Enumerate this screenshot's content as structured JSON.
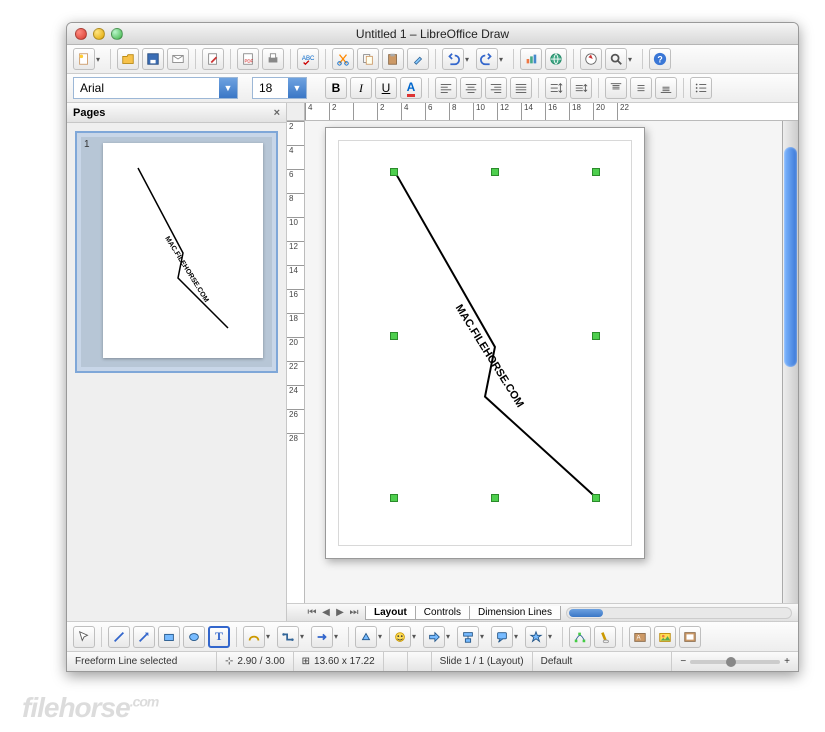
{
  "window": {
    "title": "Untitled 1 – LibreOffice Draw"
  },
  "toolbar1": {
    "new": "New",
    "open": "Open",
    "save": "Save",
    "email": "E-mail",
    "edit": "Edit",
    "pdf": "PDF",
    "print": "Print",
    "spell": "Spelling",
    "cut": "Cut",
    "copy": "Copy",
    "paste": "Paste",
    "fmtbrush": "Format Paintbrush",
    "undo": "Undo",
    "redo": "Redo",
    "chart": "Chart",
    "hyperlink": "Hyperlink",
    "navigator": "Navigator",
    "zoom": "Zoom",
    "help": "Help"
  },
  "toolbar2": {
    "font_name": "Arial",
    "font_size": "18",
    "bold": "B",
    "italic": "I",
    "underline": "U",
    "fontcolor": "A",
    "align_left": "Left",
    "align_center": "Center",
    "align_right": "Right",
    "align_just": "Justify",
    "inc_spc": "Increase Spacing",
    "dec_spc": "Decrease Spacing",
    "top": "Top",
    "vcenter": "Center",
    "bottom": "Bottom",
    "bullets": "Bullets"
  },
  "pages_panel": {
    "title": "Pages",
    "close": "×",
    "thumb_number": "1",
    "thumb_text": "MAC.FILEHORSE.COM"
  },
  "rulers": {
    "h": [
      "4",
      "2",
      "",
      "2",
      "4",
      "6",
      "8",
      "10",
      "12",
      "14",
      "16",
      "18",
      "20",
      "22"
    ],
    "v": [
      "2",
      "4",
      "6",
      "8",
      "10",
      "12",
      "14",
      "16",
      "18",
      "20",
      "22",
      "24",
      "26",
      "28"
    ]
  },
  "canvas": {
    "object_text": "MAC.FILEHORSE.COM"
  },
  "tabs": {
    "layout": "Layout",
    "controls": "Controls",
    "dimension": "Dimension Lines"
  },
  "drawbar": {
    "select": "Select",
    "line": "Line",
    "arrow": "Arrow",
    "rect": "Rectangle",
    "ellipse": "Ellipse",
    "text": "T",
    "curve": "Curve",
    "connector": "Connector",
    "arrows": "Lines & Arrows",
    "basic": "3D",
    "symbol": "Symbol",
    "block": "Block Arrows",
    "flow": "Flowchart",
    "callout": "Callout",
    "star": "Star",
    "points": "Points",
    "glue": "Glue Points",
    "fontwork": "Fontwork",
    "fromfile": "From File",
    "gallery": "Gallery"
  },
  "status": {
    "selection": "Freeform Line selected",
    "pos": "2.90 / 3.00",
    "size": "13.60 x 17.22",
    "slide": "Slide 1 / 1 (Layout)",
    "style": "Default",
    "zoom_out": "−",
    "zoom_in": "+"
  },
  "watermark": {
    "brand": "filehorse",
    "tld": ".com"
  }
}
